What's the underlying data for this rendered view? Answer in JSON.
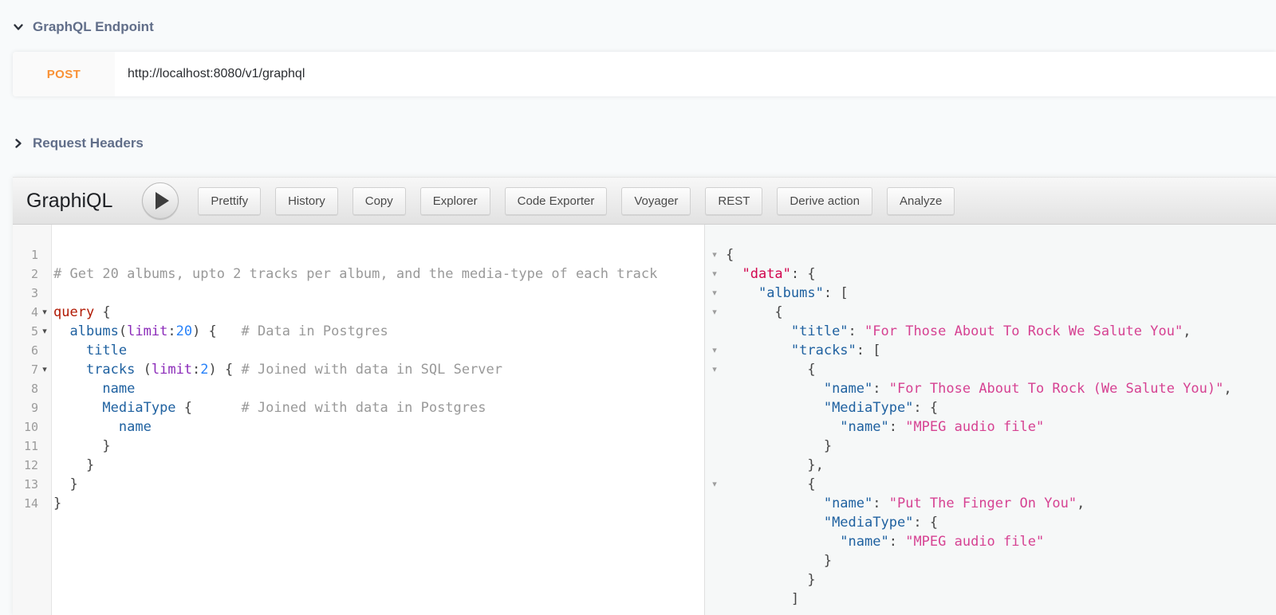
{
  "endpoint_section": {
    "title": "GraphQL Endpoint",
    "method": "POST",
    "url": "http://localhost:8080/v1/graphql"
  },
  "headers_section": {
    "title": "Request Headers"
  },
  "graphiql": {
    "title": "GraphiQL",
    "toolbar": [
      "Prettify",
      "History",
      "Copy",
      "Explorer",
      "Code Exporter",
      "Voyager",
      "REST",
      "Derive action",
      "Analyze"
    ],
    "editor": {
      "fold_lines": [
        4,
        5,
        7
      ],
      "lines": [
        [],
        [
          {
            "s": "# Get 20 albums, upto 2 tracks per album, and the media-type of each track",
            "c": "com"
          }
        ],
        [],
        [
          {
            "s": "query",
            "c": "kw"
          },
          {
            "s": " {",
            "c": "pun"
          }
        ],
        [
          {
            "s": "  ",
            "c": "pln"
          },
          {
            "s": "albums",
            "c": "prop"
          },
          {
            "s": "(",
            "c": "pun"
          },
          {
            "s": "limit",
            "c": "attr"
          },
          {
            "s": ":",
            "c": "pun"
          },
          {
            "s": "20",
            "c": "num"
          },
          {
            "s": ") {",
            "c": "pun"
          },
          {
            "s": "   ",
            "c": "pln"
          },
          {
            "s": "# Data in Postgres",
            "c": "com"
          }
        ],
        [
          {
            "s": "    ",
            "c": "pln"
          },
          {
            "s": "title",
            "c": "prop"
          }
        ],
        [
          {
            "s": "    ",
            "c": "pln"
          },
          {
            "s": "tracks",
            "c": "prop"
          },
          {
            "s": " (",
            "c": "pun"
          },
          {
            "s": "limit",
            "c": "attr"
          },
          {
            "s": ":",
            "c": "pun"
          },
          {
            "s": "2",
            "c": "num"
          },
          {
            "s": ") { ",
            "c": "pun"
          },
          {
            "s": "# Joined with data in SQL Server",
            "c": "com"
          }
        ],
        [
          {
            "s": "      ",
            "c": "pln"
          },
          {
            "s": "name",
            "c": "prop"
          }
        ],
        [
          {
            "s": "      ",
            "c": "pln"
          },
          {
            "s": "MediaType",
            "c": "prop"
          },
          {
            "s": " {",
            "c": "pun"
          },
          {
            "s": "      ",
            "c": "pln"
          },
          {
            "s": "# Joined with data in Postgres",
            "c": "com"
          }
        ],
        [
          {
            "s": "        ",
            "c": "pln"
          },
          {
            "s": "name",
            "c": "prop"
          }
        ],
        [
          {
            "s": "      }",
            "c": "pun"
          }
        ],
        [
          {
            "s": "    }",
            "c": "pun"
          }
        ],
        [
          {
            "s": "  }",
            "c": "pun"
          }
        ],
        [
          {
            "s": "}",
            "c": "pun"
          }
        ]
      ]
    },
    "response": {
      "fold_lines": [
        1,
        2,
        3,
        4,
        6,
        7,
        13
      ],
      "lines": [
        [
          {
            "s": "{",
            "c": "pun"
          }
        ],
        [
          {
            "s": "  ",
            "c": "pln"
          },
          {
            "s": "\"data\"",
            "c": "def"
          },
          {
            "s": ": {",
            "c": "pun"
          }
        ],
        [
          {
            "s": "    ",
            "c": "pln"
          },
          {
            "s": "\"albums\"",
            "c": "prop"
          },
          {
            "s": ": [",
            "c": "pun"
          }
        ],
        [
          {
            "s": "      {",
            "c": "pun"
          }
        ],
        [
          {
            "s": "        ",
            "c": "pln"
          },
          {
            "s": "\"title\"",
            "c": "prop"
          },
          {
            "s": ": ",
            "c": "pun"
          },
          {
            "s": "\"For Those About To Rock We Salute You\"",
            "c": "str"
          },
          {
            "s": ",",
            "c": "pun"
          }
        ],
        [
          {
            "s": "        ",
            "c": "pln"
          },
          {
            "s": "\"tracks\"",
            "c": "prop"
          },
          {
            "s": ": [",
            "c": "pun"
          }
        ],
        [
          {
            "s": "          {",
            "c": "pun"
          }
        ],
        [
          {
            "s": "            ",
            "c": "pln"
          },
          {
            "s": "\"name\"",
            "c": "prop"
          },
          {
            "s": ": ",
            "c": "pun"
          },
          {
            "s": "\"For Those About To Rock (We Salute You)\"",
            "c": "str"
          },
          {
            "s": ",",
            "c": "pun"
          }
        ],
        [
          {
            "s": "            ",
            "c": "pln"
          },
          {
            "s": "\"MediaType\"",
            "c": "prop"
          },
          {
            "s": ": {",
            "c": "pun"
          }
        ],
        [
          {
            "s": "              ",
            "c": "pln"
          },
          {
            "s": "\"name\"",
            "c": "prop"
          },
          {
            "s": ": ",
            "c": "pun"
          },
          {
            "s": "\"MPEG audio file\"",
            "c": "str"
          }
        ],
        [
          {
            "s": "            }",
            "c": "pun"
          }
        ],
        [
          {
            "s": "          },",
            "c": "pun"
          }
        ],
        [
          {
            "s": "          {",
            "c": "pun"
          }
        ],
        [
          {
            "s": "            ",
            "c": "pln"
          },
          {
            "s": "\"name\"",
            "c": "prop"
          },
          {
            "s": ": ",
            "c": "pun"
          },
          {
            "s": "\"Put The Finger On You\"",
            "c": "str"
          },
          {
            "s": ",",
            "c": "pun"
          }
        ],
        [
          {
            "s": "            ",
            "c": "pln"
          },
          {
            "s": "\"MediaType\"",
            "c": "prop"
          },
          {
            "s": ": {",
            "c": "pun"
          }
        ],
        [
          {
            "s": "              ",
            "c": "pln"
          },
          {
            "s": "\"name\"",
            "c": "prop"
          },
          {
            "s": ": ",
            "c": "pun"
          },
          {
            "s": "\"MPEG audio file\"",
            "c": "str"
          }
        ],
        [
          {
            "s": "            }",
            "c": "pun"
          }
        ],
        [
          {
            "s": "          }",
            "c": "pun"
          }
        ],
        [
          {
            "s": "        ]",
            "c": "pun"
          }
        ]
      ]
    }
  },
  "icons": {
    "endpoint_toggle": "chevron-down-icon",
    "headers_toggle": "chevron-right-icon",
    "execute": "play-icon",
    "fold_open": "triangle-down-icon"
  },
  "colors": {
    "page_background": "#f8fafb",
    "heading": "#616e89",
    "method_orange": "#f99135",
    "result_background": "#f6f8f8",
    "syntax": {
      "keyword": "#B11A04",
      "field": "#1F61A0",
      "argument": "#8B2BB9",
      "number": "#2882F9",
      "comment": "#999999",
      "punctuation": "#454545",
      "result_key": "#D2054E",
      "string": "#D64292"
    }
  }
}
